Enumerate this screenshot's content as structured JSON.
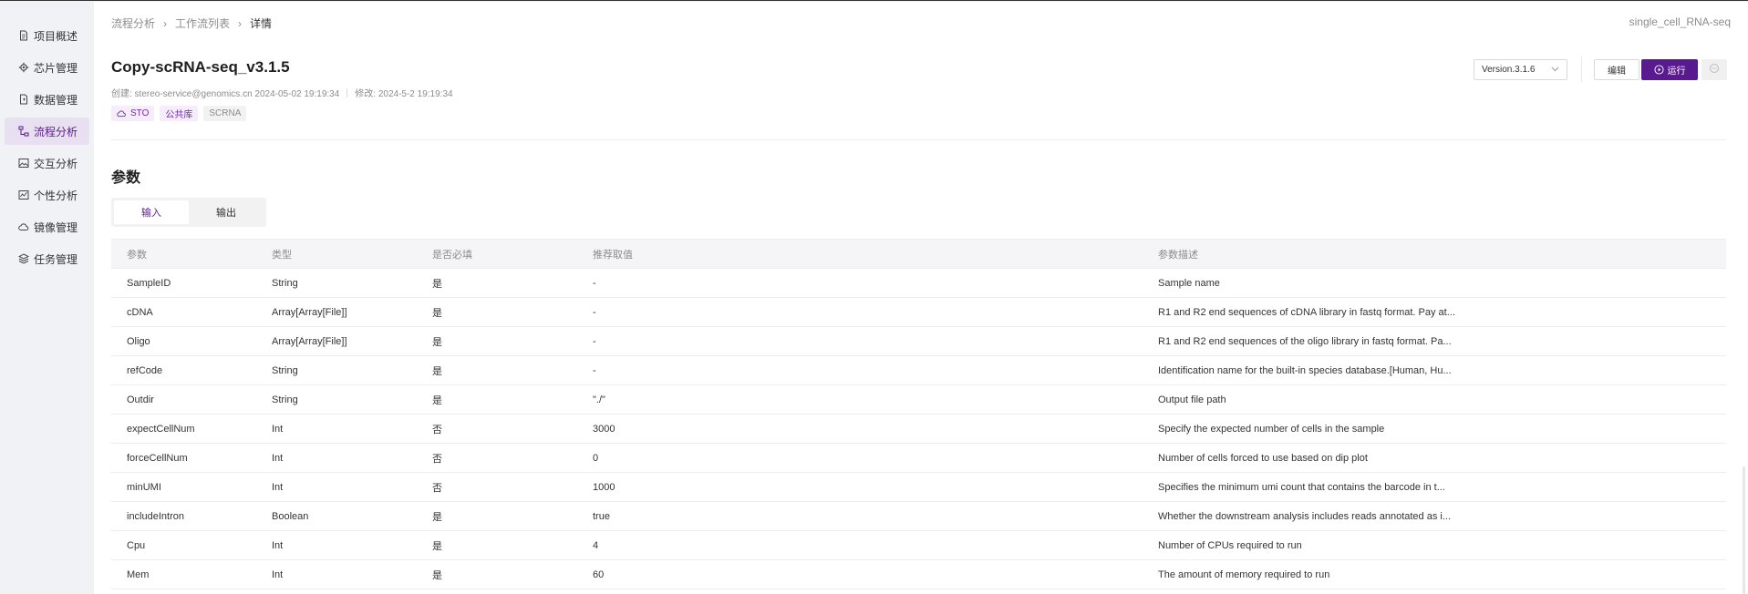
{
  "sidebar": {
    "items": [
      {
        "label": "项目概述",
        "icon": "document-icon"
      },
      {
        "label": "芯片管理",
        "icon": "gear-icon"
      },
      {
        "label": "数据管理",
        "icon": "file-icon"
      },
      {
        "label": "流程分析",
        "icon": "flow-icon",
        "active": true
      },
      {
        "label": "交互分析",
        "icon": "image-icon"
      },
      {
        "label": "个性分析",
        "icon": "chart-icon"
      },
      {
        "label": "镜像管理",
        "icon": "cloud-icon"
      },
      {
        "label": "任务管理",
        "icon": "layers-icon"
      }
    ]
  },
  "breadcrumb": {
    "items": [
      "流程分析",
      "工作流列表",
      "详情"
    ]
  },
  "header": {
    "right_label": "single_cell_RNA-seq",
    "title": "Copy-scRNA-seq_v3.1.5",
    "created": "创建: stereo-service@genomics.cn 2024-05-02 19:19:34",
    "modified": "修改: 2024-5-2 19:19:34",
    "tags": [
      "STO",
      "公共库",
      "SCRNA"
    ],
    "version": "Version.3.1.6",
    "edit_label": "编辑",
    "run_label": "运行"
  },
  "params": {
    "section_title": "参数",
    "tabs": [
      "输入",
      "输出"
    ],
    "columns": [
      "参数",
      "类型",
      "是否必填",
      "推荐取值",
      "参数描述"
    ],
    "rows": [
      [
        "SampleID",
        "String",
        "是",
        "-",
        "Sample name"
      ],
      [
        "cDNA",
        "Array[Array[File]]",
        "是",
        "-",
        "R1 and R2 end sequences of cDNA library in fastq format. Pay at..."
      ],
      [
        "Oligo",
        "Array[Array[File]]",
        "是",
        "-",
        "R1 and R2 end sequences of the oligo library in fastq format. Pa..."
      ],
      [
        "refCode",
        "String",
        "是",
        "-",
        "Identification name for the built-in species database.[Human, Hu..."
      ],
      [
        "Outdir",
        "String",
        "是",
        "\"./\"",
        "Output file path"
      ],
      [
        "expectCellNum",
        "Int",
        "否",
        "3000",
        "Specify the expected number of cells in the sample"
      ],
      [
        "forceCellNum",
        "Int",
        "否",
        "0",
        "Number of cells forced to use based on dip plot"
      ],
      [
        "minUMI",
        "Int",
        "否",
        "1000",
        "Specifies the minimum umi count that contains the barcode in t..."
      ],
      [
        "includeIntron",
        "Boolean",
        "是",
        "true",
        "Whether the downstream analysis includes reads annotated as i..."
      ],
      [
        "Cpu",
        "Int",
        "是",
        "4",
        "Number of CPUs required to run"
      ],
      [
        "Mem",
        "Int",
        "是",
        "60",
        "The amount of memory required to run"
      ]
    ]
  },
  "colors": {
    "accent": "#5a1a8f",
    "sidebar_bg": "#f0f2f5",
    "active_bg": "#e8dff0"
  }
}
